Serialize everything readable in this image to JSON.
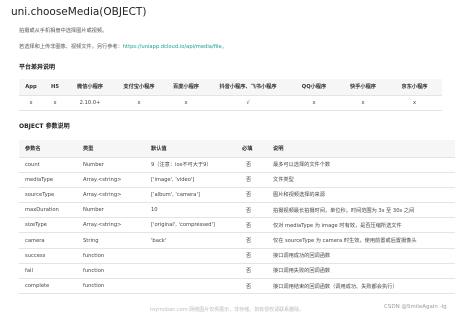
{
  "title": "uni.chooseMedia(OBJECT)",
  "intro": "拍摄或从手机相册中选择图片或视频。",
  "migrate_prefix": "若选择和上传非图像、视频文件，另行参考：",
  "migrate_link": "https://uniapp.dcloud.io/api/media/file。",
  "platform_heading": "平台差异说明",
  "platform_table": {
    "headers": [
      "App",
      "H5",
      "微信小程序",
      "支付宝小程序",
      "百度小程序",
      "抖音小程序、飞书小程序",
      "QQ小程序",
      "快手小程序",
      "京东小程序"
    ],
    "row": [
      "x",
      "x",
      "2.10.0+",
      "x",
      "x",
      "√",
      "x",
      "x",
      "x"
    ]
  },
  "params_heading": "OBJECT 参数说明",
  "params_table": {
    "headers": [
      "参数名",
      "类型",
      "默认值",
      "必填",
      "说明"
    ],
    "rows": [
      [
        "count",
        "Number",
        "9（注意：ios不可大于9）",
        "否",
        "最多可以选择的文件个数"
      ],
      [
        "mediaType",
        "Array.<string>",
        "['image', 'video']",
        "否",
        "文件类型"
      ],
      [
        "sourceType",
        "Array.<string>",
        "['album', 'camera']",
        "否",
        "图片和视频选择的来源"
      ],
      [
        "maxDuration",
        "Number",
        "10",
        "否",
        "拍摄视频最长拍摄时间，单位秒。时间范围为 3s 至 30s 之间"
      ],
      [
        "sizeType",
        "Array.<string>",
        "['original', 'compressed']",
        "否",
        "仅对 mediaType 为 image 时有效，是否压缩所选文件"
      ],
      [
        "camera",
        "String",
        "'back'",
        "否",
        "仅在 sourceType 为 camera 时生效，使用前置或后置摄像头"
      ],
      [
        "success",
        "function",
        "",
        "否",
        "接口调用成功的回调函数"
      ],
      [
        "fail",
        "function",
        "",
        "否",
        "接口调用失败的回调函数"
      ],
      [
        "complete",
        "function",
        "",
        "否",
        "接口调用结束的回调函数（调用成功、失败都会执行）"
      ]
    ]
  },
  "watermark_left": "toymoban.com 网络图片仅供展示，非存储，如有侵权请联系删除。",
  "watermark_right": "CSDN @SmileAgain -lg"
}
